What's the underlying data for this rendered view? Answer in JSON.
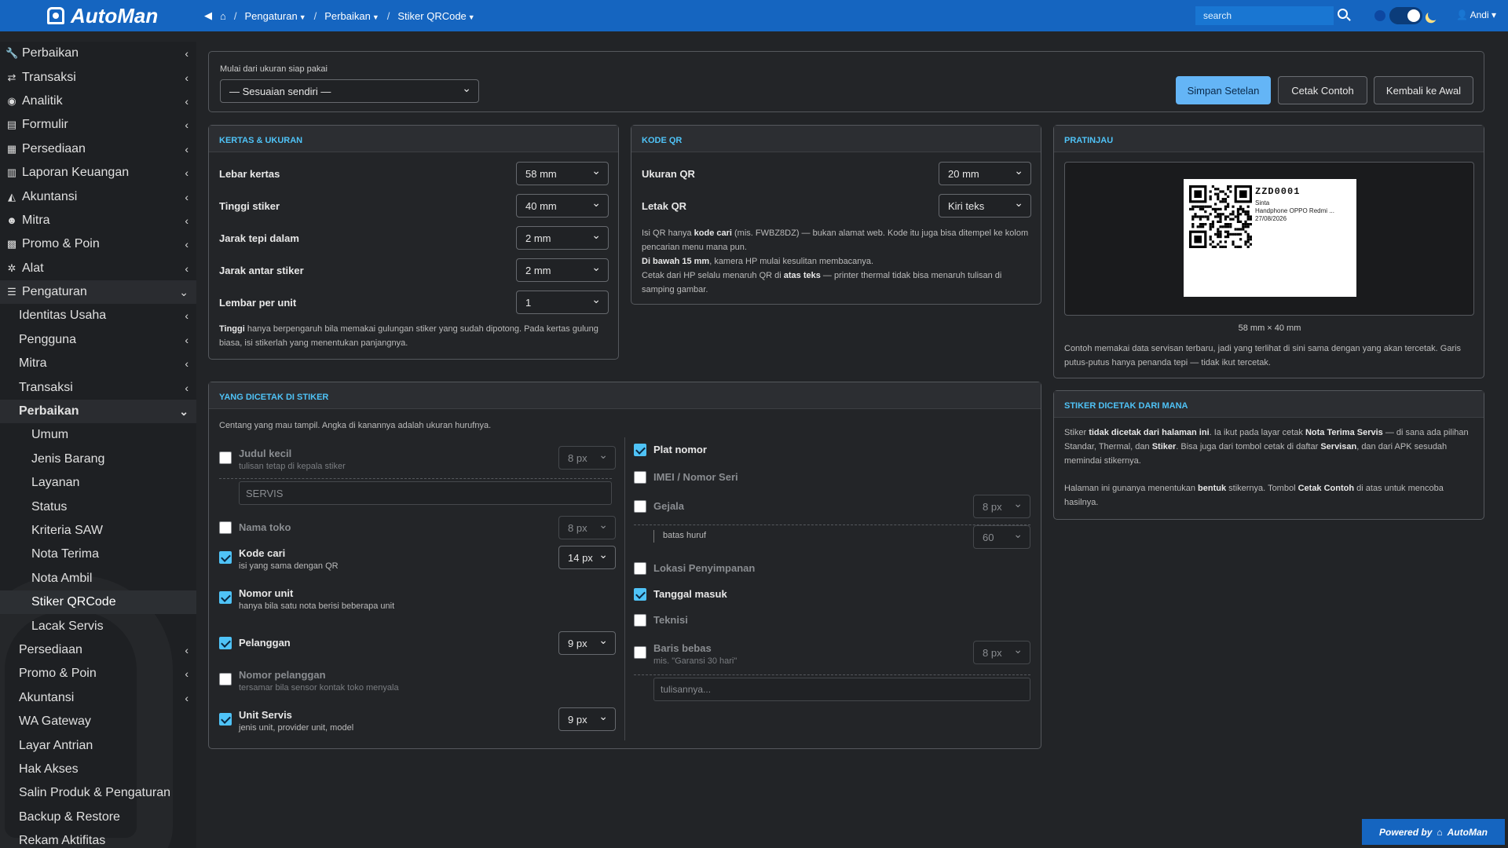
{
  "brand": {
    "name": "AutoMan"
  },
  "breadcrumb": {
    "items": [
      "Pengaturan",
      "Perbaikan",
      "Stiker QRCode"
    ]
  },
  "search": {
    "placeholder": "search"
  },
  "user": {
    "name": "Andi"
  },
  "sidebar": {
    "items": [
      {
        "label": "Perbaikan",
        "icon": "wrench-icon",
        "glyph": "🔧"
      },
      {
        "label": "Transaksi",
        "icon": "exchange-icon",
        "glyph": "⇄"
      },
      {
        "label": "Analitik",
        "icon": "binoculars-icon",
        "glyph": "◉"
      },
      {
        "label": "Formulir",
        "icon": "form-icon",
        "glyph": "▤"
      },
      {
        "label": "Persediaan",
        "icon": "grid-icon",
        "glyph": "▦"
      },
      {
        "label": "Laporan Keuangan",
        "icon": "chart-icon",
        "glyph": "▥"
      },
      {
        "label": "Akuntansi",
        "icon": "area-chart-icon",
        "glyph": "◭"
      },
      {
        "label": "Mitra",
        "icon": "users-icon",
        "glyph": "☻"
      },
      {
        "label": "Promo & Poin",
        "icon": "gift-icon",
        "glyph": "▩"
      },
      {
        "label": "Alat",
        "icon": "gear-icon",
        "glyph": "✲"
      },
      {
        "label": "Pengaturan",
        "icon": "sliders-icon",
        "glyph": "☰"
      }
    ],
    "sub": [
      "Identitas Usaha",
      "Pengguna",
      "Mitra",
      "Transaksi",
      "Perbaikan"
    ],
    "sub2": [
      "Umum",
      "Jenis Barang",
      "Layanan",
      "Status",
      "Kriteria SAW",
      "Nota Terima",
      "Nota Ambil",
      "Stiker QRCode",
      "Lacak Servis"
    ],
    "sub3": [
      "Persediaan",
      "Promo & Poin",
      "Akuntansi",
      "WA Gateway",
      "Layar Antrian",
      "Hak Akses",
      "Salin Produk & Pengaturan",
      "Backup & Restore",
      "Rekam Aktifitas"
    ]
  },
  "toolbar": {
    "preset_label": "Mulai dari ukuran siap pakai",
    "preset_value": "— Sesuaian sendiri —",
    "save": "Simpan Setelan",
    "print": "Cetak Contoh",
    "reset": "Kembali ke Awal"
  },
  "paper": {
    "title": "KERTAS & UKURAN",
    "rows": [
      {
        "label": "Lebar kertas",
        "value": "58 mm"
      },
      {
        "label": "Tinggi stiker",
        "value": "40 mm"
      },
      {
        "label": "Jarak tepi dalam",
        "value": "2 mm"
      },
      {
        "label": "Jarak antar stiker",
        "value": "2 mm"
      },
      {
        "label": "Lembar per unit",
        "value": "1"
      }
    ],
    "note_b": "Tinggi",
    "note": " hanya berpengaruh bila memakai gulungan stiker yang sudah dipotong. Pada kertas gulung biasa, isi stikerlah yang menentukan panjangnya."
  },
  "qr": {
    "title": "KODE QR",
    "rows": [
      {
        "label": "Ukuran QR",
        "value": "20 mm"
      },
      {
        "label": "Letak QR",
        "value": "Kiri teks"
      }
    ],
    "n1a": "Isi QR hanya ",
    "n1b": "kode cari",
    "n1c": " (mis. FWBZ8DZ) — bukan alamat web. Kode itu juga bisa ditempel ke kolom pencarian menu mana pun.",
    "n2a": "Di bawah 15 mm",
    "n2b": ", kamera HP mulai kesulitan membacanya.",
    "n3a": "Cetak dari HP selalu menaruh QR di ",
    "n3b": "atas teks",
    "n3c": " — printer thermal tidak bisa menaruh tulisan di samping gambar."
  },
  "preview": {
    "title": "PRATINJAU",
    "code": "ZZD0001",
    "name": "Sinta",
    "unit": "Handphone OPPO Redmi ...",
    "date": "27/08/2026",
    "size": "58 mm × 40 mm",
    "note": "Contoh memakai data servisan terbaru, jadi yang terlihat di sini sama dengan yang akan tercetak. Garis putus-putus hanya penanda tepi — tidak ikut tercetak."
  },
  "source": {
    "title": "STIKER DICETAK DARI MANA",
    "p1a": "Stiker ",
    "p1b": "tidak dicetak dari halaman ini",
    "p1c": ". Ia ikut pada layar cetak ",
    "p1d": "Nota Terima Servis",
    "p1e": " — di sana ada pilihan Standar, Thermal, dan ",
    "p1f": "Stiker",
    "p1g": ". Bisa juga dari tombol cetak di daftar ",
    "p1h": "Servisan",
    "p1i": ", dan dari APK sesudah memindai stikernya.",
    "p2a": "Halaman ini gunanya menentukan ",
    "p2b": "bentuk",
    "p2c": " stikernya. Tombol ",
    "p2d": "Cetak Contoh",
    "p2e": " di atas untuk mencoba hasilnya."
  },
  "fields": {
    "title": "YANG DICETAK DI STIKER",
    "intro": "Centang yang mau tampil. Angka di kanannya adalah ukuran hurufnya.",
    "left": [
      {
        "label": "Judul kecil",
        "sub": "tulisan tetap di kepala stiker",
        "size": "8 px",
        "on": false
      },
      {
        "label": "Nama toko",
        "sub": "",
        "size": "8 px",
        "on": false
      },
      {
        "label": "Kode cari",
        "sub": "isi yang sama dengan QR",
        "size": "14 px",
        "on": true
      },
      {
        "label": "Nomor unit",
        "sub": "hanya bila satu nota berisi beberapa unit",
        "size": "",
        "on": true
      },
      {
        "label": "Pelanggan",
        "sub": "",
        "size": "9 px",
        "on": true
      },
      {
        "label": "Nomor pelanggan",
        "sub": "tersamar bila sensor kontak toko menyala",
        "size": "",
        "on": false
      },
      {
        "label": "Unit Servis",
        "sub": "jenis unit, provider unit, model",
        "size": "9 px",
        "on": true
      }
    ],
    "judul_input": "SERVIS",
    "right": [
      {
        "label": "Plat nomor",
        "sub": "",
        "size": "",
        "on": true
      },
      {
        "label": "IMEI / Nomor Seri",
        "sub": "",
        "size": "",
        "on": false
      },
      {
        "label": "Gejala",
        "sub": "",
        "size": "8 px",
        "on": false
      },
      {
        "label": "Lokasi Penyimpanan",
        "sub": "",
        "size": "",
        "on": false
      },
      {
        "label": "Tanggal masuk",
        "sub": "",
        "size": "",
        "on": true
      },
      {
        "label": "Teknisi",
        "sub": "",
        "size": "",
        "on": false
      },
      {
        "label": "Baris bebas",
        "sub": "mis. \"Garansi 30 hari\"",
        "size": "8 px",
        "on": false
      }
    ],
    "batas_label": "batas huruf",
    "batas_value": "60",
    "free_placeholder": "tulisannya..."
  },
  "footer": {
    "powered": "Powered by",
    "brand": "AutoMan"
  },
  "colors": {
    "accent": "#4fc3f7",
    "topbar": "#1565c0",
    "primary_button": "#64b5f6"
  }
}
